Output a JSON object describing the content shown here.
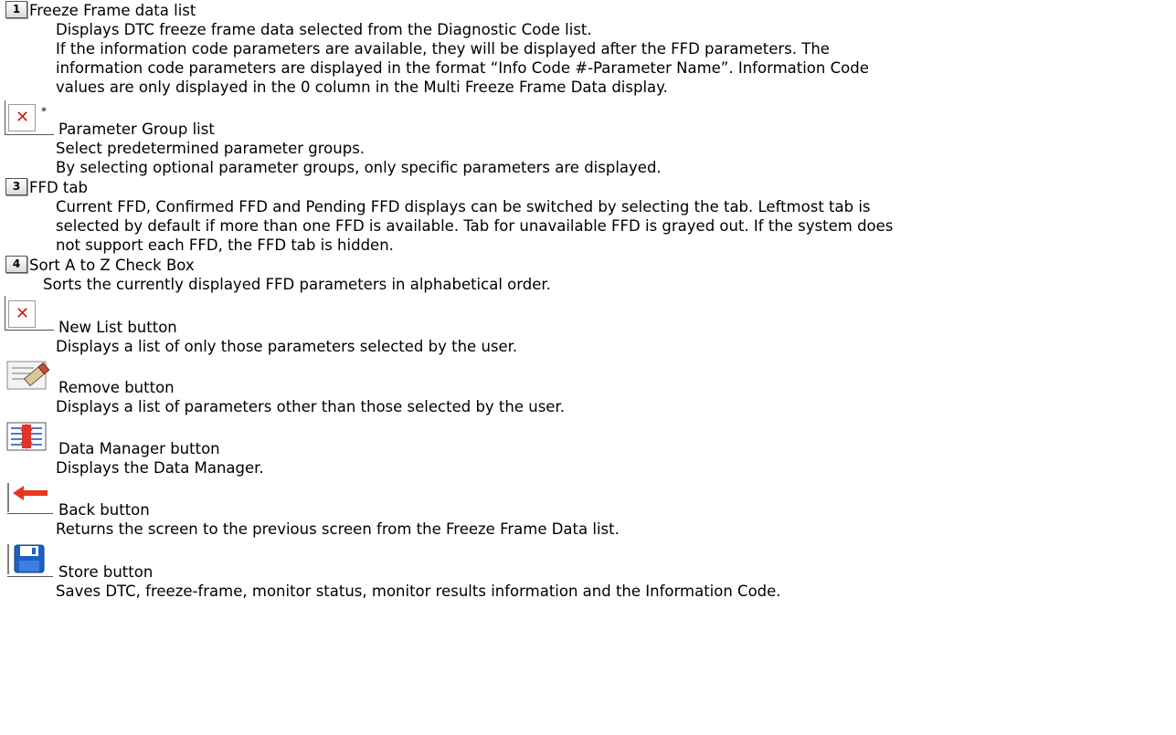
{
  "sections": [
    {
      "number": "1",
      "title": "Freeze Frame data list",
      "lines": [
        "Displays DTC freeze frame data selected from the Diagnostic Code list.",
        "If the information code parameters are available, they will be displayed after the FFD parameters. The",
        "information code parameters are displayed in the format “Info Code #-Parameter Name”. Information Code",
        "values are only displayed in the 0 column in the Multi Freeze Frame Data display."
      ]
    },
    {
      "marker": "*",
      "title": "Parameter Group list",
      "lines": [
        "Select predetermined parameter groups.",
        "By selecting optional parameter groups, only specific parameters are displayed."
      ]
    },
    {
      "number": "3",
      "title": "FFD tab",
      "lines": [
        "Current FFD, Confirmed FFD and Pending FFD displays can be switched by selecting the tab. Leftmost tab is",
        "selected by default if more than one FFD is available. Tab for unavailable FFD is grayed out. If the system does",
        "not support each FFD, the FFD tab is hidden."
      ]
    },
    {
      "number": "4",
      "title": "Sort A to Z Check Box",
      "lines": [
        "Sorts the currently displayed FFD parameters in alphabetical order."
      ]
    },
    {
      "title": "New List button",
      "lines": [
        "Displays a list of only those parameters selected by the user."
      ]
    },
    {
      "title": "Remove button",
      "lines": [
        "Displays a list of parameters other than those selected by the user."
      ]
    },
    {
      "title": "Data Manager button",
      "lines": [
        "Displays the Data Manager."
      ]
    },
    {
      "title": "Back button",
      "lines": [
        "Returns the screen to the previous screen from the Freeze Frame Data list."
      ]
    },
    {
      "title": "Store button",
      "lines": [
        "Saves DTC, freeze-frame, monitor status, monitor results information and the Information Code."
      ]
    }
  ],
  "icons": {
    "broken_image": "broken-image-icon",
    "remove": "eraser-icon",
    "data_manager": "data-manager-icon",
    "back": "back-arrow-icon",
    "store": "floppy-disk-icon"
  },
  "colors": {
    "broken_x": "#d11a1a",
    "back_arrow": "#e8371f",
    "floppy": "#1d5fc4"
  }
}
